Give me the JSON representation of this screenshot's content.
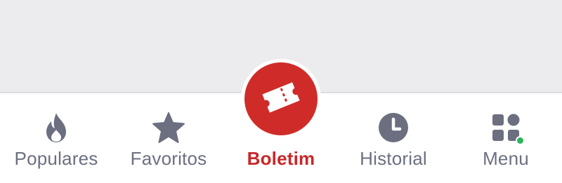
{
  "tabbar": {
    "tabs": [
      {
        "id": "populares",
        "label": "Populares",
        "icon": "flame-icon",
        "active": false
      },
      {
        "id": "favoritos",
        "label": "Favoritos",
        "icon": "star-icon",
        "active": false
      },
      {
        "id": "boletim",
        "label": "Boletim",
        "icon": "ticket-icon",
        "active": true
      },
      {
        "id": "historial",
        "label": "Historial",
        "icon": "clock-icon",
        "active": false
      },
      {
        "id": "menu",
        "label": "Menu",
        "icon": "grid-icon",
        "active": false,
        "badge": "notification-dot"
      }
    ]
  },
  "colors": {
    "background": "#ececee",
    "tabbar": "#ffffff",
    "inactive": "#6c6f80",
    "active": "#c8282a",
    "fab": "#cf2c29",
    "badge": "#2db35a"
  }
}
